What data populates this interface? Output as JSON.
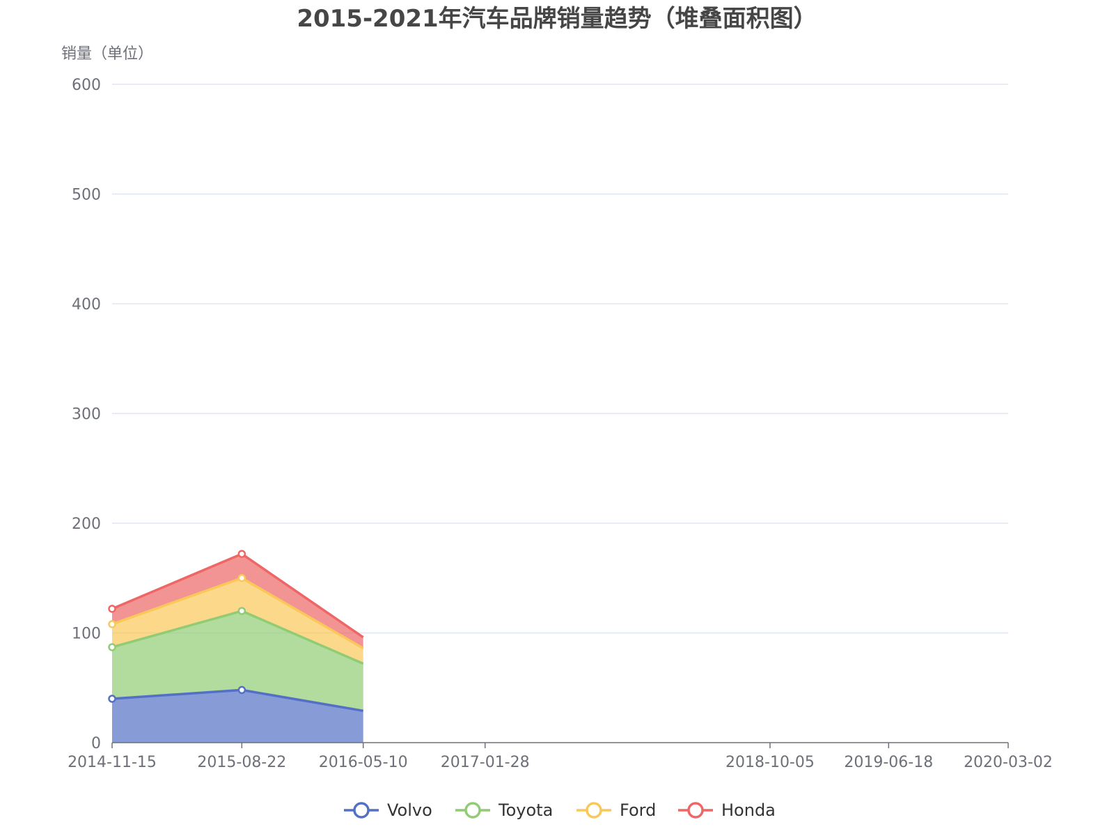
{
  "chart_data": {
    "type": "area",
    "stacked": true,
    "title": "2015-2021年汽车品牌销量趋势（堆叠面积图）",
    "xlabel": "",
    "ylabel": "销量（单位）",
    "ylim": [
      0,
      600
    ],
    "yticks": [
      0,
      100,
      200,
      300,
      400,
      500,
      600
    ],
    "xlim": [
      "2014-11-15",
      "2020-03-02"
    ],
    "xticks": [
      "2014-11-15",
      "2015-08-22",
      "2016-05-10",
      "2017-01-28",
      "2018-10-05",
      "2019-06-18",
      "2020-03-02"
    ],
    "grid": true,
    "legend_position": "bottom",
    "x": [
      "2014-11-15",
      "2015-08-22",
      "2016-05-10"
    ],
    "series": [
      {
        "name": "Volvo",
        "color": "#5470c6",
        "values": [
          40,
          48,
          29
        ]
      },
      {
        "name": "Toyota",
        "color": "#91cc75",
        "values": [
          47,
          72,
          43
        ]
      },
      {
        "name": "Ford",
        "color": "#fac858",
        "values": [
          21,
          30,
          14
        ]
      },
      {
        "name": "Honda",
        "color": "#ee6666",
        "values": [
          14,
          22,
          10
        ]
      }
    ]
  }
}
